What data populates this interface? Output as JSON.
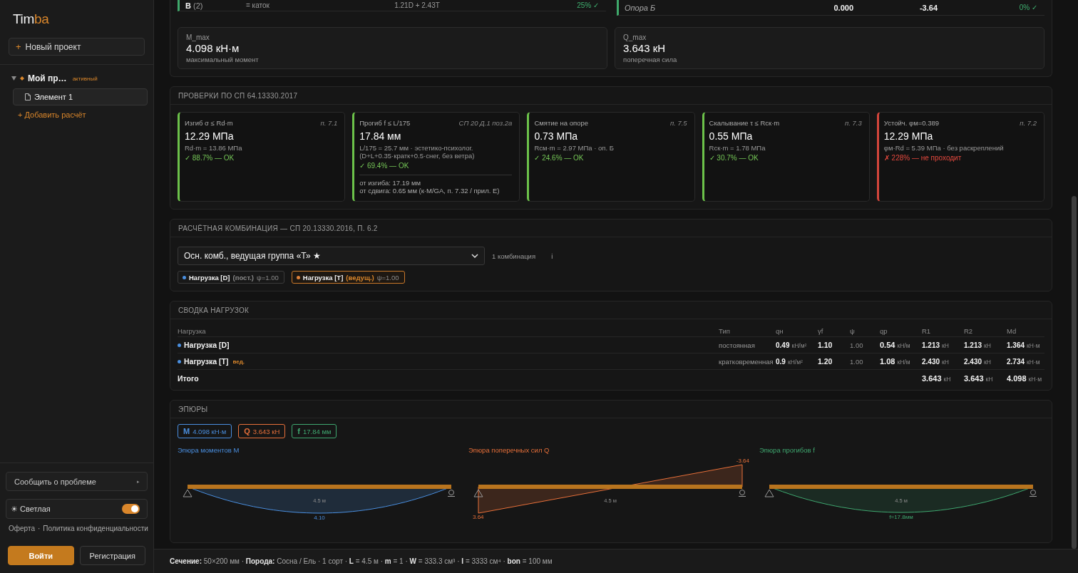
{
  "sidebar": {
    "logo": [
      "Tim",
      "ba"
    ],
    "new_project": {
      "icon": "+",
      "label": "Новый проект"
    },
    "tree": [
      {
        "label": "Мой пр…",
        "badge": "активный",
        "expanded": true,
        "children": [
          {
            "label": "Элемент 1",
            "selected": true
          }
        ]
      }
    ],
    "add_calculation": "+ Добавить расчёт",
    "report": {
      "label": "Сообщить о проблеме",
      "arrow": "▸"
    },
    "theme": {
      "label": "☀ Светлая",
      "on": true
    },
    "legal": {
      "links": [
        "Оферта",
        "Политика конфиденциальности"
      ],
      "separator": "·"
    },
    "auth": [
      {
        "label": "Войти",
        "kind": "primary"
      },
      {
        "label": "Регистрация",
        "kind": "secondary"
      }
    ]
  },
  "results": {
    "tables": [
      {
        "kind": "combinations",
        "rows": [
          {
            "cells": [
              "**В** (2)",
              "= каток",
              "1.21D + 2.43T",
              "25% ✓"
            ],
            "passed": true
          }
        ]
      },
      {
        "kind": "supports",
        "rows": [
          {
            "cells": [
              "Опора Б",
              "0.000",
              "-3.64",
              "0% ✓"
            ],
            "passed": true
          }
        ]
      }
    ],
    "metrics": [
      {
        "label": "M_max",
        "value": "4.098 кН·м",
        "caption": "максимальный момент"
      },
      {
        "label": "Q_max",
        "value": "3.643 кН",
        "caption": "поперечная сила"
      }
    ]
  },
  "checks": {
    "title": "ПРОВЕРКИ ПО СП 64.13330.2017",
    "items": [
      {
        "title": "Изгиб σ ≤ Rd·m",
        "clause": "п. 7.1",
        "value": "12.29 МПа",
        "detail": [
          "Rd·m = 13.86 МПа"
        ],
        "result": "✓ 88.7% — OK",
        "passed": true
      },
      {
        "title": "Прогиб f ≤ L/175",
        "clause": "СП 20 Д.1 поз.2а",
        "value": "17.84 мм",
        "detail": [
          "L/175 = 25.7 мм · эстетико-психолог.",
          "(D+L+0.35·кратк+0.5·снег, без ветра)"
        ],
        "result": "✓ 69.4% — OK",
        "passed": true,
        "notes": [
          "от изгиба: 17.19 мм",
          "от сдвига: 0.65 мм (к·M/GA, п. 7.32 / прил. Е)"
        ]
      },
      {
        "title": "Смятие на опоре",
        "clause": "п. 7.5",
        "value": "0.73 МПа",
        "detail": [
          "Rсм·m = 2.97 МПа · оп. Б"
        ],
        "result": "✓ 24.6% — OK",
        "passed": true
      },
      {
        "title": "Скалывание τ ≤ Rск·m",
        "clause": "п. 7.3",
        "value": "0.55 МПа",
        "detail": [
          "Rск·m = 1.78 МПа"
        ],
        "result": "✓ 30.7% — OK",
        "passed": true
      },
      {
        "title": "Устойч. φм=0.389",
        "clause": "п. 7.2",
        "value": "12.29 МПа",
        "detail": [
          "φм·Rd = 5.39 МПа · без раскреплений"
        ],
        "result": "✗ 228% — не проходит",
        "passed": false
      }
    ]
  },
  "combination": {
    "title": "РАСЧЁТНАЯ КОМБИНАЦИЯ — СП 20.13330.2016, П. 6.2",
    "select": {
      "value": "Осн. комб., ведущая группа «Т» ★"
    },
    "count": "1 комбинация",
    "info": "ℹ",
    "loads": [
      {
        "name": "Нагрузка [D]",
        "role": "(пост.)",
        "psi": "ψ=1.00",
        "color": "#4a8fe0",
        "leading": false
      },
      {
        "name": "Нагрузка [T]",
        "role": "(ведущ.)",
        "psi": "ψ=1.00",
        "color": "#e0823a",
        "leading": true
      }
    ]
  },
  "summary": {
    "title": "СВОДКА НАГРУЗОК",
    "columns": [
      "Нагрузка",
      "Тип",
      "qн",
      "γf",
      "ψ",
      "qр",
      "R1",
      "R2",
      "Md"
    ],
    "rows": [
      {
        "color": "#4a8fe0",
        "cells": [
          {
            "value": "Нагрузка [D]"
          },
          {
            "value": "постоянная"
          },
          {
            "value": "0.49",
            "unit": "кН/м²"
          },
          {
            "value": "1.10"
          },
          {
            "value": "1.00"
          },
          {
            "value": "0.54",
            "unit": "кН/м"
          },
          {
            "value": "1.213",
            "unit": "кН"
          },
          {
            "value": "1.213",
            "unit": "кН"
          },
          {
            "value": "1.364",
            "unit": "кН·м"
          }
        ]
      },
      {
        "color": "#4a8fe0",
        "cells": [
          {
            "value": "Нагрузка [T]",
            "tag": "вед."
          },
          {
            "value": "кратковременная"
          },
          {
            "value": "0.9",
            "unit": "кН/м²"
          },
          {
            "value": "1.20"
          },
          {
            "value": "1.00"
          },
          {
            "value": "1.08",
            "unit": "кН/м"
          },
          {
            "value": "2.430",
            "unit": "кН"
          },
          {
            "value": "2.430",
            "unit": "кН"
          },
          {
            "value": "2.734",
            "unit": "кН·м"
          }
        ]
      }
    ],
    "total": {
      "cells": [
        {
          "value": "Итого"
        },
        {},
        {},
        {},
        {},
        {},
        {
          "value": "3.643",
          "unit": "кН"
        },
        {
          "value": "3.643",
          "unit": "кН"
        },
        {
          "value": "4.098",
          "unit": "кН·м"
        }
      ]
    }
  },
  "epures": {
    "title": "ЭПЮРЫ",
    "chips": [
      {
        "symbol": "M",
        "value": "4.098 кН·м",
        "color": "#4a8fe0"
      },
      {
        "symbol": "Q",
        "value": "3.643 кН",
        "color": "#e8703a"
      },
      {
        "symbol": "f",
        "value": "17.84 мм",
        "color": "#3fa870"
      }
    ],
    "diagrams": [
      {
        "kind": "moment",
        "title": "Эпюра моментов M",
        "span": "4.5 м",
        "labels": [
          "4.10"
        ]
      },
      {
        "kind": "shear",
        "title": "Эпюра поперечных сил Q",
        "span": "4.5 м",
        "labels": [
          "-3.64",
          "3.64"
        ]
      },
      {
        "kind": "deflection",
        "title": "Эпюра прогибов f",
        "span": "4.5 м",
        "labels": [
          "f=17.8мм"
        ]
      }
    ]
  },
  "status_bar": {
    "text": "**Сечение:** 50×200 мм · **Порода:** Сосна / Ель · 1 сорт · **L** = 4.5 м · **m** = 1 · **W** = 333.3 см³ · **I** = 3333 см⁴ · **bon** = 100 мм"
  }
}
